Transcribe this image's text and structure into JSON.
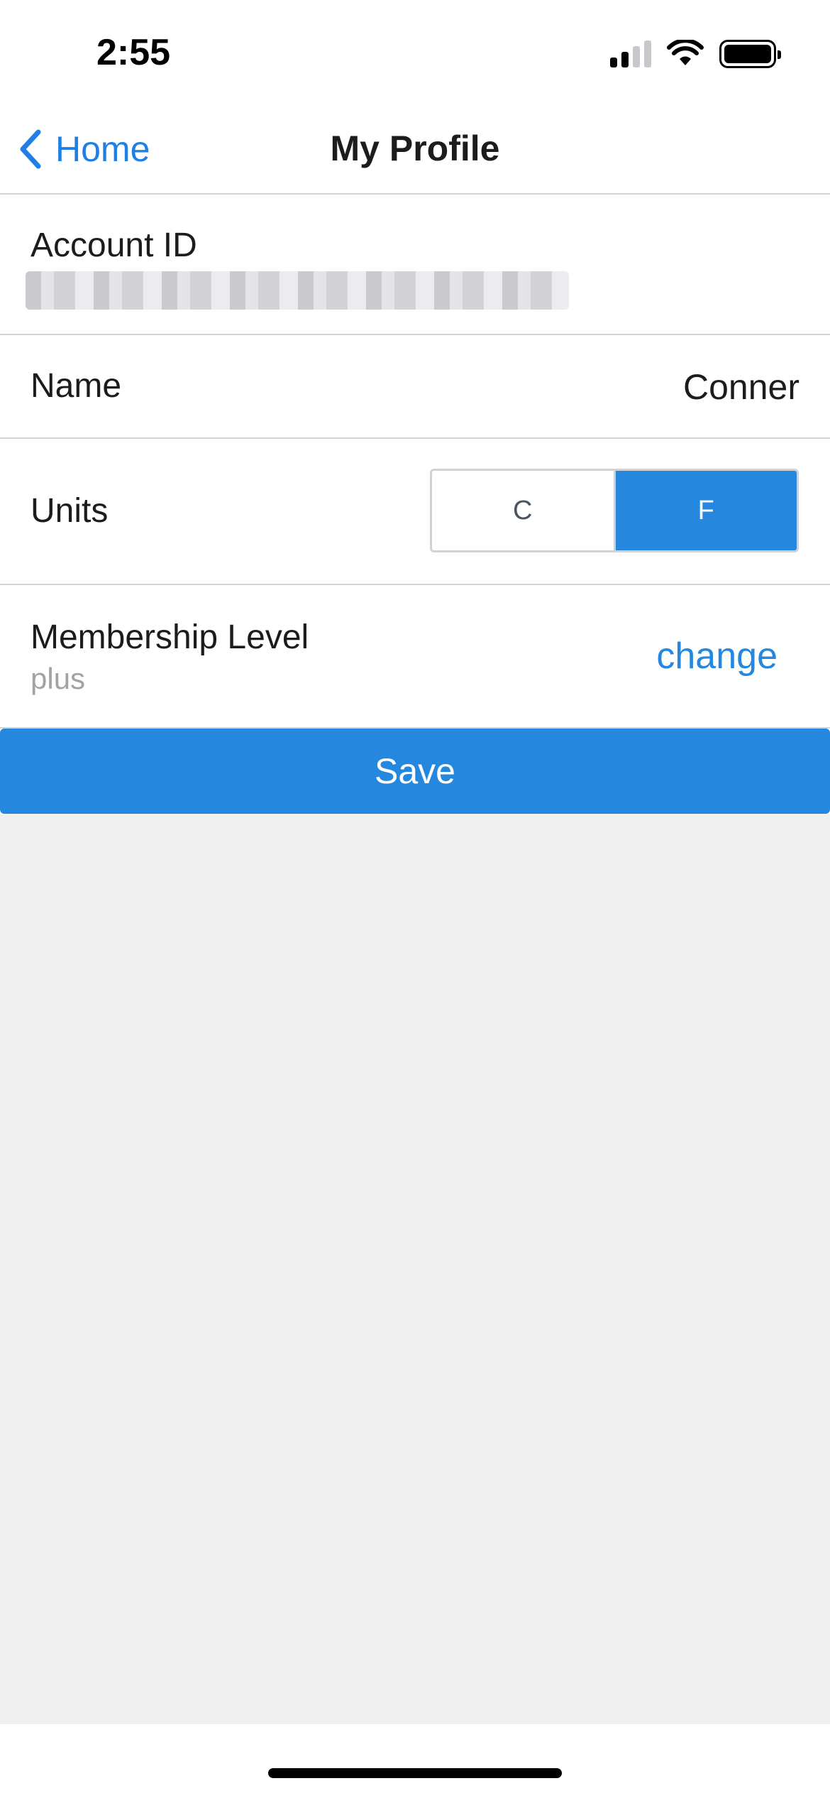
{
  "status_bar": {
    "time": "2:55",
    "icons": [
      "cellular-signal-icon",
      "wifi-icon",
      "battery-icon"
    ]
  },
  "nav": {
    "back_label": "Home",
    "title": "My Profile"
  },
  "profile": {
    "account_id_label": "Account ID",
    "account_id_value": "",
    "name_label": "Name",
    "name_value": "Conner",
    "units_label": "Units",
    "units_options": [
      "C",
      "F"
    ],
    "units_selected": "F",
    "membership_label": "Membership Level",
    "membership_value": "plus",
    "change_label": "change"
  },
  "save_label": "Save",
  "colors": {
    "accent": "#2588de",
    "link": "#1f7fe5",
    "background": "#f0f0f1",
    "divider": "#d1d1d6"
  }
}
